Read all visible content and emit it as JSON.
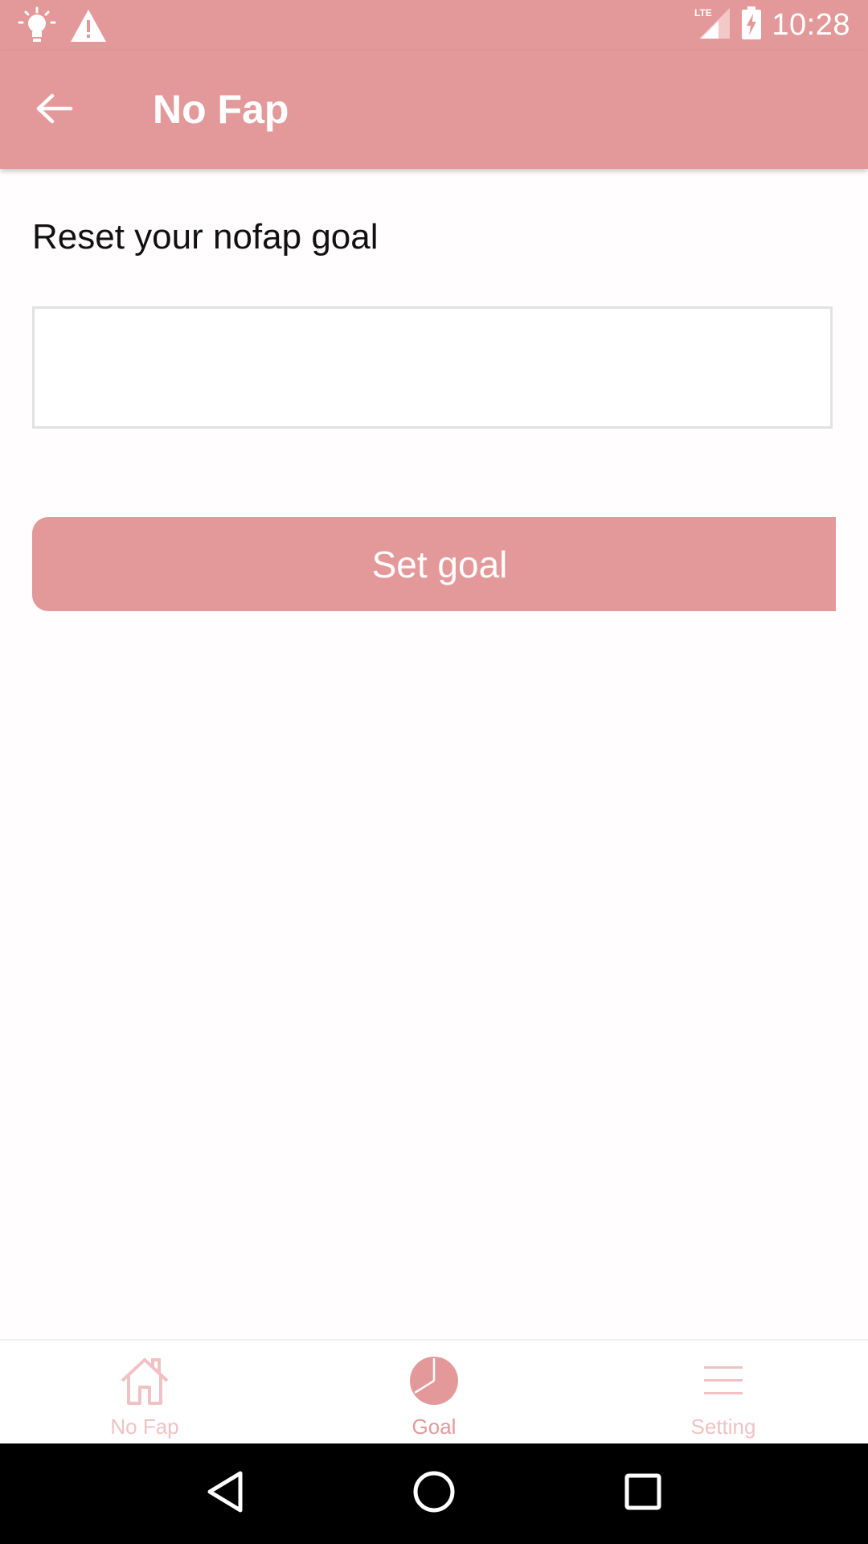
{
  "status_bar": {
    "time": "10:28",
    "network": "LTE",
    "icons": [
      "lightbulb-icon",
      "warning-icon",
      "lte-signal-icon",
      "battery-charging-icon"
    ]
  },
  "app_bar": {
    "title": "No Fap",
    "back_icon": "arrow-back-icon"
  },
  "main": {
    "heading": "Reset your nofap goal",
    "goal_input": {
      "value": "",
      "placeholder": ""
    },
    "set_goal_label": "Set goal"
  },
  "bottom_nav": {
    "items": [
      {
        "label": "No Fap",
        "icon": "home-icon",
        "active": false
      },
      {
        "label": "Goal",
        "icon": "pie-chart-icon",
        "active": true
      },
      {
        "label": "Setting",
        "icon": "menu-icon",
        "active": false
      }
    ]
  },
  "system_nav": {
    "icons": [
      "back-triangle-icon",
      "home-circle-icon",
      "recents-square-icon"
    ]
  },
  "colors": {
    "accent": "#e3999a",
    "nav_inactive": "#f0c2c3",
    "text_dark": "#111111"
  }
}
